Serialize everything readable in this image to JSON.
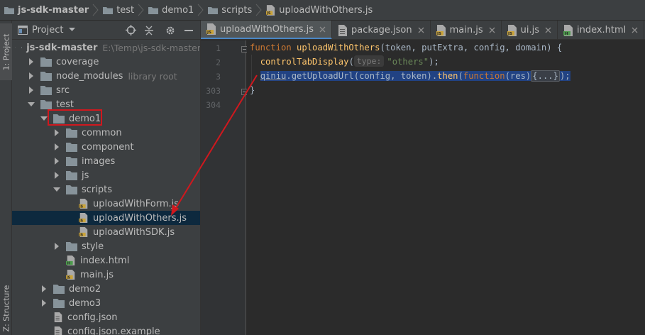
{
  "breadcrumb": [
    "js-sdk-master",
    "test",
    "demo1",
    "scripts",
    "uploadWithOthers.js"
  ],
  "left_stripe": {
    "project_tab": "1: Project",
    "structure_tab": "Z: Structure"
  },
  "project_panel": {
    "title": "Project",
    "tree": [
      {
        "label": "js-sdk-master",
        "hint": "E:\\Temp\\js-sdk-master",
        "type": "folder",
        "expanded": true,
        "bold": true
      },
      {
        "label": "coverage",
        "type": "folder",
        "expanded": false
      },
      {
        "label": "node_modules",
        "hint": "library root",
        "type": "folder",
        "expanded": false
      },
      {
        "label": "src",
        "type": "folder",
        "expanded": false
      },
      {
        "label": "test",
        "type": "folder",
        "expanded": true
      },
      {
        "label": "demo1",
        "type": "folder",
        "expanded": true
      },
      {
        "label": "common",
        "type": "folder",
        "expanded": false
      },
      {
        "label": "component",
        "type": "folder",
        "expanded": false
      },
      {
        "label": "images",
        "type": "folder",
        "expanded": false
      },
      {
        "label": "js",
        "type": "folder",
        "expanded": false
      },
      {
        "label": "scripts",
        "type": "folder",
        "expanded": true
      },
      {
        "label": "uploadWithForm.js",
        "type": "js"
      },
      {
        "label": "uploadWithOthers.js",
        "type": "js",
        "selected": true
      },
      {
        "label": "uploadWithSDK.js",
        "type": "js"
      },
      {
        "label": "style",
        "type": "folder",
        "expanded": false
      },
      {
        "label": "index.html",
        "type": "html"
      },
      {
        "label": "main.js",
        "type": "js"
      },
      {
        "label": "demo2",
        "type": "folder",
        "expanded": false
      },
      {
        "label": "demo3",
        "type": "folder",
        "expanded": false
      },
      {
        "label": "config.json",
        "type": "json"
      },
      {
        "label": "config.json.example",
        "type": "json"
      }
    ]
  },
  "editor": {
    "tabs": [
      {
        "label": "uploadWithOthers.js",
        "type": "js",
        "active": true
      },
      {
        "label": "package.json",
        "type": "json"
      },
      {
        "label": "main.js",
        "type": "js"
      },
      {
        "label": "ui.js",
        "type": "js"
      },
      {
        "label": "index.html",
        "type": "html"
      },
      {
        "label": "index",
        "type": "css"
      }
    ],
    "line_numbers": [
      "1",
      "2",
      "3",
      "303",
      "304"
    ],
    "code": {
      "line1": {
        "kw": "function",
        "fn": "uploadWithOthers",
        "rest": "(token, putExtra, config, domain) {"
      },
      "line2": {
        "fn": "controlTabDisplay",
        "open": "(",
        "param_hint": "type:",
        "str": "\"others\"",
        "close": ");"
      },
      "line3": {
        "obj": "qiniu",
        "call": ".getUploadUrl(config, token).",
        "then": "then",
        "paren": "(",
        "kw": "function",
        "args": "(res)",
        "folded": "{...}",
        "end": ");"
      },
      "line4": {
        "text": "}"
      }
    }
  },
  "colors": {
    "annotation": "#d0181e",
    "selection": "#214283",
    "tree_selected": "#0d293e",
    "tab_underline": "#4a88c7"
  }
}
